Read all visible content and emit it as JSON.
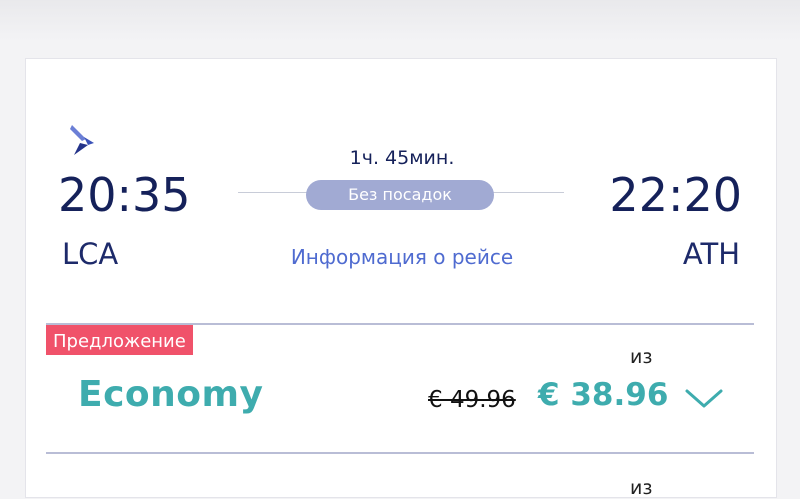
{
  "flight": {
    "departure_time": "20:35",
    "arrival_time": "22:20",
    "departure_code": "LCA",
    "arrival_code": "ATH",
    "duration": "1ч. 45мин.",
    "stops": "Без посадок",
    "info_link": "Информация о рейсе"
  },
  "fare": {
    "badge": "Предложение",
    "from_label": "из",
    "cabin": "Economy",
    "old_price": "€ 49.96",
    "new_price": "€ 38.96"
  },
  "next_fare": {
    "from_label": "из"
  },
  "colors": {
    "navy": "#15215a",
    "teal": "#3eacae",
    "link": "#4f6bd0",
    "pill": "#a1aad3",
    "badge": "#f0526a"
  },
  "icons": {
    "airline_logo": "airline-logo-icon",
    "expand": "chevron-down-icon"
  }
}
